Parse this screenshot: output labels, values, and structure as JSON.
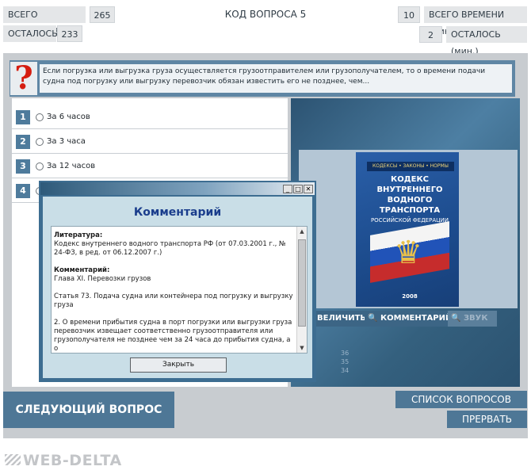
{
  "header": {
    "total_questions_label": "ВСЕГО ВОПРОСОВ",
    "total_questions_value": "265",
    "remaining_label": "ОСТАЛОСЬ",
    "remaining_value": "233",
    "question_code": "КОД ВОПРОСА 5",
    "total_time_label": "ВСЕГО ВРЕМЕНИ (мин.)",
    "total_time_value": "10",
    "time_remaining_label": "ОСТАЛОСЬ (мин.)",
    "time_remaining_value": "2"
  },
  "question": {
    "icon": "question-mark-icon",
    "text": "Если погрузка или выгрузка груза осуществляется грузоотправителем или грузополучателем, то о времени подачи судна под погрузку или выгрузку перевозчик обязан известить его не позднее, чем..."
  },
  "answers": [
    {
      "num": "1",
      "text": "За 6 часов"
    },
    {
      "num": "2",
      "text": "За 3 часа"
    },
    {
      "num": "3",
      "text": "За 12 часов"
    },
    {
      "num": "4",
      "text": ""
    }
  ],
  "book": {
    "series": "КОДЕКСЫ • ЗАКОНЫ • НОРМЫ",
    "title": "КОДЕКС ВНУТРЕННЕГО ВОДНОГО ТРАНСПОРТА",
    "subtitle": "РОССИЙСКОЙ ФЕДЕРАЦИИ",
    "year": "2008"
  },
  "toolbar": {
    "enlarge": "ВЕЛИЧИТЬ",
    "comment": "КОММЕНТАРИЙ",
    "sound": "ЗВУК"
  },
  "side_numbers": [
    "36",
    "35",
    "34"
  ],
  "modal": {
    "title": "Комментарий",
    "literature_label": "Литература:",
    "literature_text": "Кодекс внутреннего водного транспорта РФ (от 07.03.2001 г., № 24-ФЗ, в ред. от 06.12.2007 г.)",
    "comment_label": "Комментарий:",
    "comment_text": "Глава XI. Перевозки грузов",
    "article": "Статья 73. Подача судна или контейнера под погрузку и выгрузку груза",
    "paragraph": "2. О времени прибытия судна в порт погрузки или выгрузки груза перевозчик извещает соответственно грузоотправителя или грузополучателя не позднее чем за 24 часа до прибытия судна, а о",
    "close": "Закрыть"
  },
  "buttons": {
    "next": "СЛЕДУЮЩИЙ ВОПРОС",
    "list": "СПИСОК ВОПРОСОВ",
    "stop": "ПРЕРВАТЬ"
  },
  "logo": "WEB-DELTA",
  "colors": {
    "accent": "#4e7796",
    "question_mark": "#d51d10",
    "modal_title": "#1a3d8c"
  }
}
